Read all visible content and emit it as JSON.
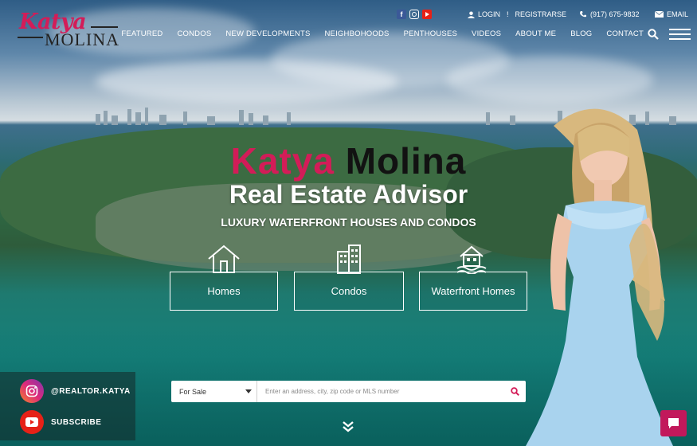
{
  "brand": {
    "script": "Katya",
    "name": "MOLINA"
  },
  "topbar": {
    "login": "LOGIN",
    "separator": "!",
    "register": "REGISTRARSE",
    "phone": "(917) 675-9832",
    "email": "EMAIL"
  },
  "nav": [
    "FEATURED",
    "CONDOS",
    "NEW DEVELOPMENTS",
    "NEIGHBOHOODS",
    "PENTHOUSES",
    "VIDEOS",
    "ABOUT ME",
    "BLOG",
    "CONTACT"
  ],
  "hero": {
    "first_name": "Katya",
    "last_name": "Molina",
    "title": "Real Estate Advisor",
    "subtitle": "LUXURY WATERFRONT HOUSES AND CONDOS"
  },
  "categories": [
    {
      "label": "Homes",
      "icon": "house-icon"
    },
    {
      "label": "Condos",
      "icon": "building-icon"
    },
    {
      "label": "Waterfront Homes",
      "icon": "waterfront-house-icon"
    }
  ],
  "social": {
    "instagram": "@REALTOR.KATYA",
    "youtube": "SUBSCRIBE"
  },
  "search": {
    "type_value": "For Sale",
    "placeholder": "Enter an address, city, zip code or MLS number"
  },
  "colors": {
    "accent": "#d31c58",
    "instagram": "#e1306c",
    "youtube": "#e62117",
    "facebook": "#3b5998",
    "chat": "#c2185b"
  }
}
